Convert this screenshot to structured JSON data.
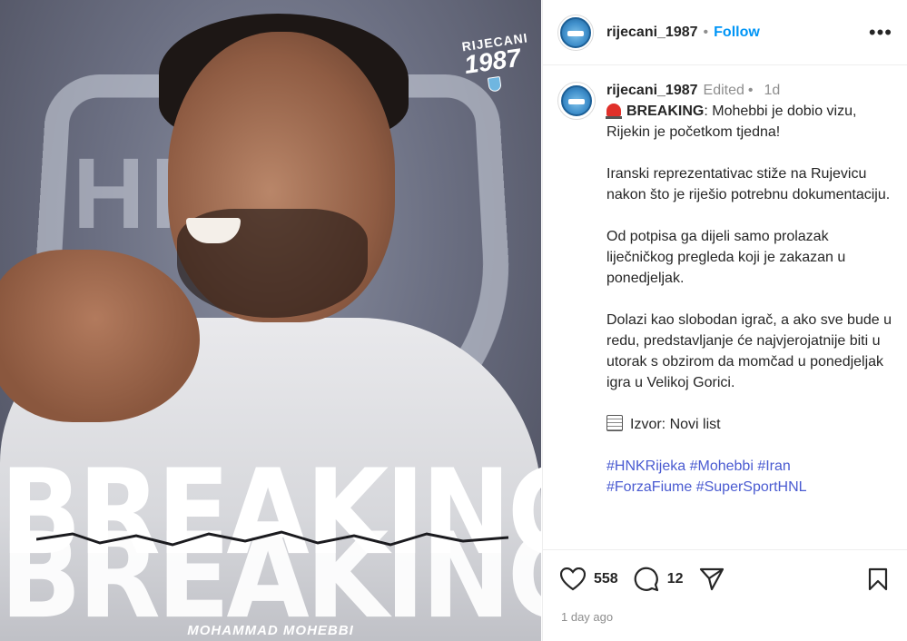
{
  "media": {
    "overlay_title_top": "BREAKING",
    "overlay_title_bottom": "BREAKING",
    "player_name": "MOHAMMAD MOHEBBI",
    "club_badge_line1": "RIJECANI",
    "club_badge_line2": "1987",
    "crest_text": "HNK"
  },
  "header": {
    "username": "rijecani_1987",
    "dot": "•",
    "follow_label": "Follow",
    "more_label": "•••"
  },
  "caption": {
    "username": "rijecani_1987",
    "edited": "Edited",
    "dot": "•",
    "time": "1d",
    "breaking_word": "BREAKING",
    "line1_rest": ": Mohebbi je dobio vizu, Rijekin je početkom tjedna!",
    "p2": "Iranski reprezentativac stiže na Rujevicu nakon što je riješio potrebnu dokumentaciju.",
    "p3": "Od potpisa ga dijeli samo prolazak liječničkog pregleda koji je zakazan u ponedjeljak.",
    "p4": "Dolazi kao slobodan igrač, a ako sve bude u redu, predstavljanje će najvjerojatnije biti u utorak s obzirom da momčad u ponedjeljak igra u Velikoj Gorici.",
    "source": "Izvor: Novi list",
    "hashtags": [
      "#HNKRijeka",
      "#Mohebbi",
      "#Iran",
      "#ForzaFiume",
      "#SuperSportHNL"
    ]
  },
  "actions": {
    "likes": "558",
    "comments": "12",
    "posted": "1 day ago"
  },
  "colors": {
    "follow": "#0095f6",
    "hashtag": "#4a5bd1",
    "muted": "#8e8e8e"
  },
  "icons": [
    "siren-icon",
    "document-icon",
    "heart-icon",
    "comment-icon",
    "share-icon",
    "bookmark-icon",
    "more-icon"
  ]
}
